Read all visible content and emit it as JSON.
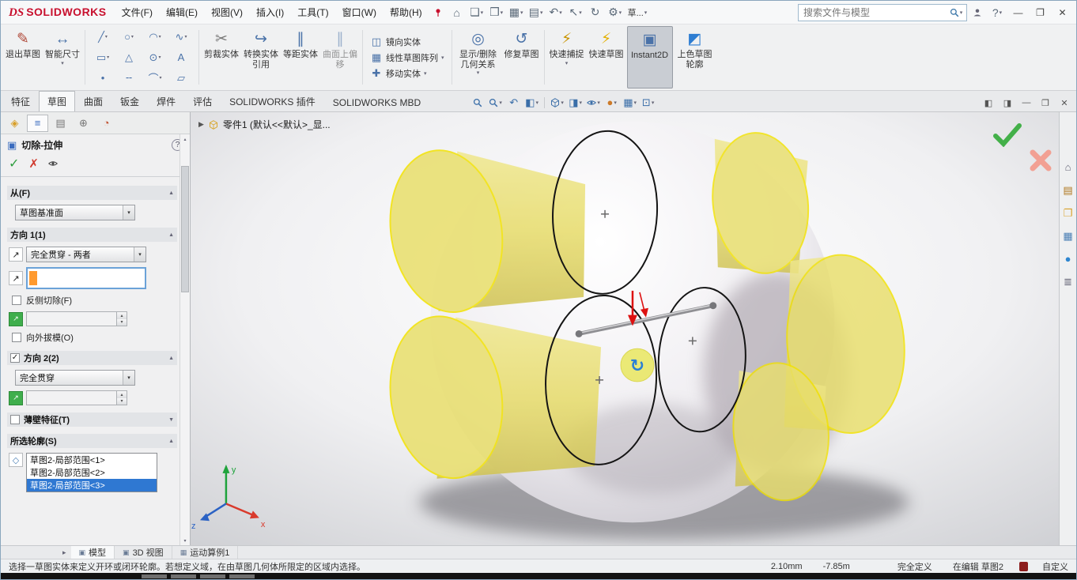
{
  "icons": {
    "home": "⌂",
    "new": "❏",
    "open": "❒",
    "save": "▦",
    "print": "▤",
    "undo": "↶",
    "select": "↖",
    "rebuild": "↻",
    "gear": "⚙",
    "dropdown": "▾",
    "up": "▴",
    "down": "▾",
    "collapse": "▲",
    "expand": "▼",
    "close": "✕",
    "minimize": "—",
    "restore": "❐",
    "help": "?",
    "flyout": "▶",
    "check": "✓",
    "cross": "✗",
    "pencil": "✎",
    "dimension": "↔",
    "line": "╱",
    "rect": "▭",
    "circle": "○",
    "arc": "◠",
    "arc3": "⌒",
    "spline": "∿",
    "polygon": "△",
    "ellipse": "⊙",
    "text": "A",
    "point": "•",
    "centerline": "╌",
    "parallelogram": "▱",
    "scissors": "✂",
    "convert": "↪",
    "offset": "∥",
    "mirror": "◫",
    "pattern": "▦",
    "move": "✚",
    "relations": "◎",
    "repair": "↺",
    "lightning": "⚡",
    "shaded_contour": "◩",
    "arrow_ne": "↗",
    "diamond": "◇",
    "section": "◧",
    "display_style": "◨",
    "appearance": "●",
    "scene": "▦",
    "monitor": "⊡",
    "prev_view": "↶",
    "library": "▤",
    "folder": "❐",
    "palette": "▦",
    "props": "≣",
    "pane_left": "◧",
    "pane_right": "◨",
    "cube_tab": "▣",
    "pie": "◔",
    "crosshair": "⊕",
    "list": "≡",
    "leaf": "◈",
    "nav": "▸"
  },
  "titlebar": {
    "logo_ds": "DS",
    "logo_text": "SOLIDWORKS",
    "menus": [
      "文件(F)",
      "编辑(E)",
      "视图(V)",
      "插入(I)",
      "工具(T)",
      "窗口(W)",
      "帮助(H)"
    ],
    "truncated_command": "草...",
    "search": {
      "placeholder": "搜索文件与模型"
    }
  },
  "ribbon": {
    "exit_sketch": "退出草图",
    "smart_dimension": "智能尺寸",
    "trim": "剪裁实体",
    "convert": "转换实体引用",
    "offset": "等距实体",
    "surface_offset": "曲面上偏移",
    "mirror": "镜向实体",
    "linear_pattern": "线性草图阵列",
    "move": "移动实体",
    "relations": "显示/删除几何关系",
    "repair": "修复草图",
    "quick_snaps": "快速捕捉",
    "rapid_sketch": "快速草图",
    "instant2d": "Instant2D",
    "shaded_contours": "上色草图轮廓"
  },
  "tabs": [
    "特征",
    "草图",
    "曲面",
    "钣金",
    "焊件",
    "评估",
    "SOLIDWORKS 插件",
    "SOLIDWORKS MBD"
  ],
  "pm": {
    "title": "切除-拉伸",
    "from": {
      "label": "从(F)",
      "value": "草图基准面"
    },
    "dir1": {
      "label": "方向 1(1)",
      "value": "完全贯穿 - 两者",
      "flip": "反侧切除(F)",
      "draft": "向外拔模(O)"
    },
    "dir2": {
      "label": "方向 2(2)",
      "value": "完全贯穿"
    },
    "thin": {
      "label": "薄壁特征(T)"
    },
    "contours": {
      "label": "所选轮廓(S)",
      "items": [
        "草图2-局部范围<1>",
        "草图2-局部范围<2>",
        "草图2-局部范围<3>"
      ]
    }
  },
  "graphics": {
    "breadcrumb": "零件1 (默认<<默认>_显...",
    "triad": {
      "x": "x",
      "y": "y",
      "z": "z"
    }
  },
  "doctabs": [
    "模型",
    "3D 视图",
    "运动算例1"
  ],
  "statusbar": {
    "message": "选择一草图实体来定义开环或闭环轮廓。若想定义域，在由草图几何体所限定的区域内选择。",
    "coord_x": "2.10mm",
    "coord_y": "-7.85m",
    "state": "完全定义",
    "editing": "在编辑 草图2",
    "custom": "自定义"
  }
}
